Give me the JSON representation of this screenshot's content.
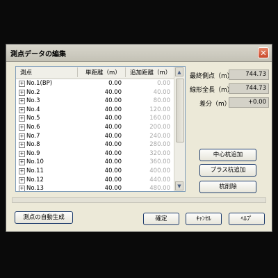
{
  "window": {
    "title": "測点データの編集",
    "close_glyph": "✕"
  },
  "table": {
    "headers": {
      "name": "測点",
      "dist": "単距離（m）",
      "add": "追加距離（m）"
    },
    "rows": [
      {
        "name": "No.1(BP)",
        "dist": "0.00",
        "add": "0.00"
      },
      {
        "name": "No.2",
        "dist": "40.00",
        "add": "40.00"
      },
      {
        "name": "No.3",
        "dist": "40.00",
        "add": "80.00"
      },
      {
        "name": "No.4",
        "dist": "40.00",
        "add": "120.00"
      },
      {
        "name": "No.5",
        "dist": "40.00",
        "add": "160.00"
      },
      {
        "name": "No.6",
        "dist": "40.00",
        "add": "200.00"
      },
      {
        "name": "No.7",
        "dist": "40.00",
        "add": "240.00"
      },
      {
        "name": "No.8",
        "dist": "40.00",
        "add": "280.00"
      },
      {
        "name": "No.9",
        "dist": "40.00",
        "add": "320.00"
      },
      {
        "name": "No.10",
        "dist": "40.00",
        "add": "360.00"
      },
      {
        "name": "No.11",
        "dist": "40.00",
        "add": "400.00"
      },
      {
        "name": "No.12",
        "dist": "40.00",
        "add": "440.00"
      },
      {
        "name": "No.13",
        "dist": "40.00",
        "add": "480.00"
      }
    ]
  },
  "stats": {
    "final_label": "最終側点（m）",
    "final_value": "744.73",
    "total_label": "線形全長（m）",
    "total_value": "744.73",
    "diff_label": "差分（m）",
    "diff_value": "+0.00"
  },
  "buttons": {
    "add_center": "中心杭追加",
    "add_plus": "プラス杭追加",
    "delete": "杭削除",
    "auto_gen": "測点の自動生成",
    "ok": "確定",
    "cancel": "ｷｬﾝｾﾙ",
    "help": "ﾍﾙﾌﾟ"
  },
  "scroll": {
    "up": "▲",
    "down": "▼"
  },
  "expander_glyph": "+"
}
